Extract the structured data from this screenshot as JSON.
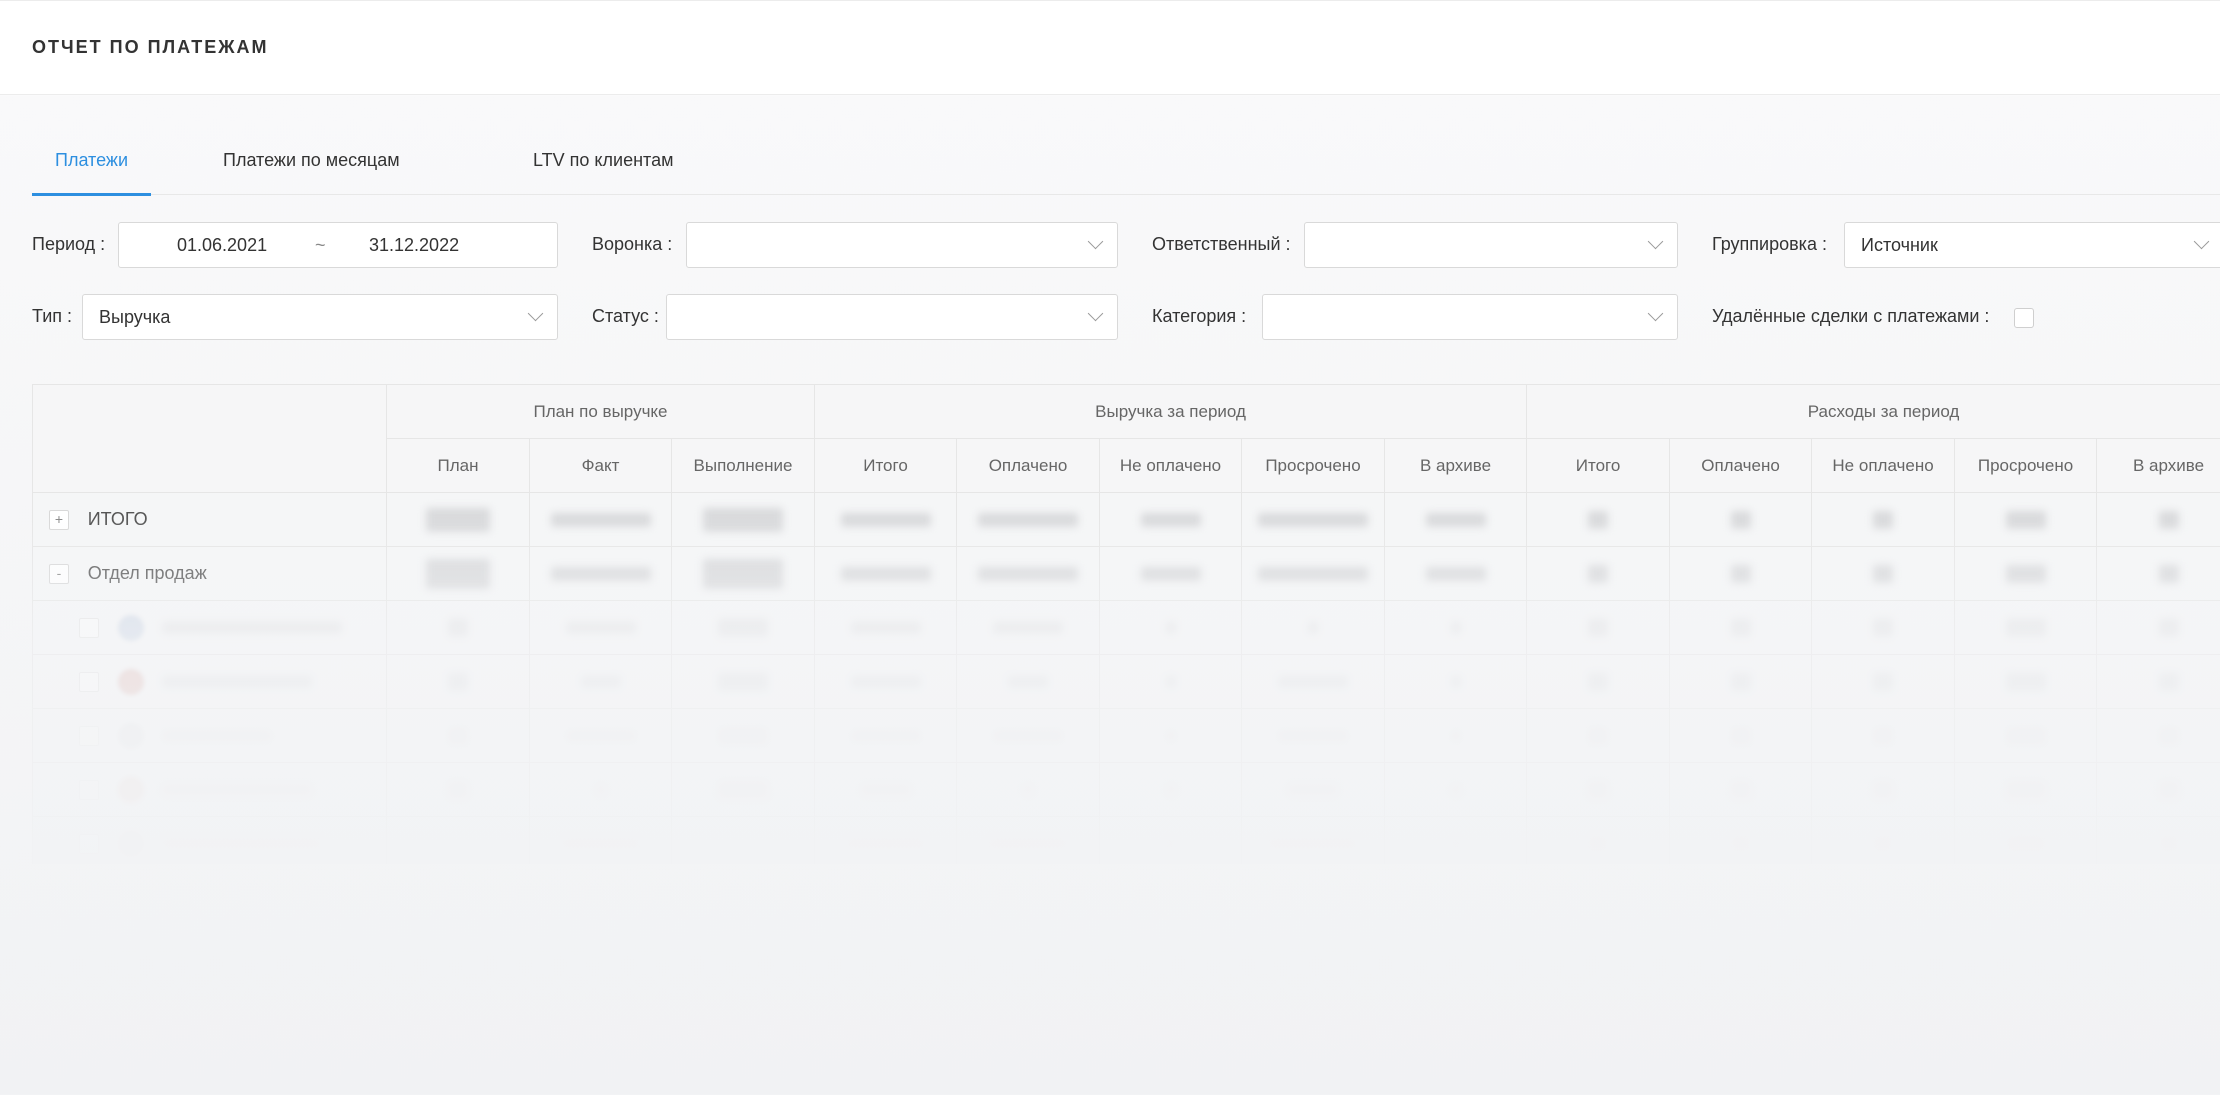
{
  "header": {
    "title": "ОТЧЕТ ПО ПЛАТЕЖАМ"
  },
  "tabs": [
    {
      "label": "Платежи",
      "active": true
    },
    {
      "label": "Платежи по месяцам",
      "active": false
    },
    {
      "label": "LTV по клиентам",
      "active": false
    }
  ],
  "filters": {
    "period_label": "Период :",
    "period_from": "01.06.2021",
    "period_separator": "~",
    "period_to": "31.12.2022",
    "funnel_label": "Воронка :",
    "funnel_value": "",
    "responsible_label": "Ответственный :",
    "responsible_value": "",
    "grouping_label": "Группировка :",
    "grouping_value": "Источник",
    "type_label": "Тип :",
    "type_value": "Выручка",
    "status_label": "Статус :",
    "status_value": "",
    "category_label": "Категория :",
    "category_value": "",
    "deleted_deals_label": "Удалённые сделки с платежами :",
    "deleted_deals_checked": false
  },
  "table": {
    "groups": [
      "План по выручке",
      "Выручка за период",
      "Расходы за период"
    ],
    "columns": [
      "План",
      "Факт",
      "Выполнение",
      "Итого",
      "Оплачено",
      "Не оплачено",
      "Просрочено",
      "В архиве",
      "Итого",
      "Оплачено",
      "Не оплачено",
      "Просрочено",
      "В архиве"
    ],
    "rows": [
      {
        "toggle": "+",
        "label": "ИТОГО"
      },
      {
        "toggle": "-",
        "label": "Отдел продаж"
      }
    ]
  },
  "colors": {
    "accent": "#2d8fe0",
    "text": "#333333",
    "border": "#d9d9d9"
  }
}
